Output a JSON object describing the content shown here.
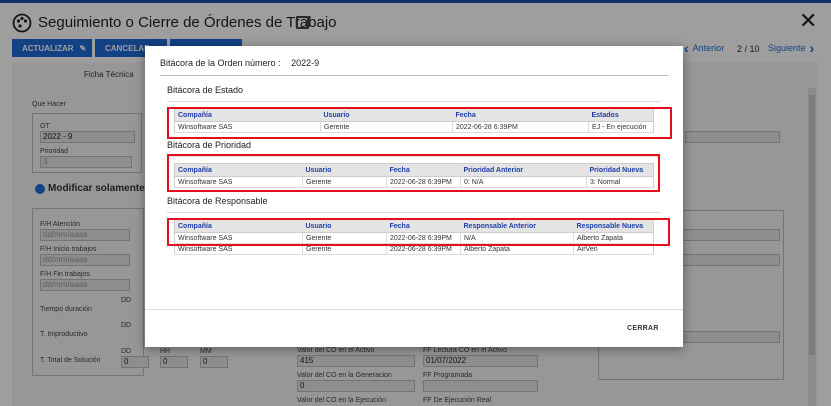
{
  "app": {
    "title": "Seguimiento o Cierre de Órdenes de Trabajo",
    "close_icon": "close-icon",
    "toolbar": {
      "update_label": "ACTUALIZAR",
      "cancel_label": "CANCELAR",
      "third_label": "OPCIONES"
    },
    "nav": {
      "prev_label": "Anterior",
      "counter": "2 / 10",
      "next_label": "Siguiente"
    }
  },
  "background": {
    "tab_label": "Ficha Técnica",
    "que_hacer_label": "Que Hacer",
    "ot_label": "OT",
    "ot_value": "2022 - 9",
    "prioridad_label": "Prioridad",
    "prioridad_value": "3",
    "modify_label": "Modificar solamente e",
    "fh_atencion_label": "F/H Atención",
    "fh_inicio_label": "F/H Inicio trabajos",
    "fh_fin_label": "F/H Fin trabajos",
    "date_placeholder": "dd/mm/aaaa",
    "tiempo_label": "Tiempo duración",
    "improductivo_label": "T. Improductivo",
    "total_label": "T. Total de Solución",
    "dd_label": "DD",
    "hh_label": "HH",
    "mm_label": "MM",
    "zero": "0",
    "valor_activo_label": "Valor del CO en el Activo",
    "valor_activo_value": "415",
    "ff_lectura_label": "FF Lectura CO en el Activo",
    "ff_lectura_value": "01/07/2022",
    "valor_generacion_label": "Valor del CO en la Generacion",
    "valor_generacion_value": "0",
    "ff_programada_label": "FF Programada",
    "valor_ejecucion_label": "Valor del CO en la Ejecución",
    "ff_ejecucion_label": "FF De Ejecución Real"
  },
  "modal": {
    "header_label": "Bitácora de la Orden número :",
    "order_number": "2022-9",
    "close_button": "CERRAR",
    "estado": {
      "title": "Bitácora de Estado",
      "columns": [
        "Compañía",
        "Usuario",
        "Fecha",
        "Estados"
      ],
      "rows": [
        [
          "Winsoftware SAS",
          "Gerente",
          "2022-06-28 6:39PM",
          "EJ - En ejecución"
        ]
      ]
    },
    "prioridad": {
      "title": "Bitácora de Prioridad",
      "columns": [
        "Compañía",
        "Usuario",
        "Fecha",
        "Prioridad Anterior",
        "Prioridad Nueva"
      ],
      "rows": [
        [
          "Winsoftware SAS",
          "Gerente",
          "2022-06-28 6:39PM",
          "0: N/A",
          "3: Normal"
        ]
      ]
    },
    "responsable": {
      "title": "Bitácora de Responsable",
      "columns": [
        "Compañía",
        "Usuario",
        "Fecha",
        "Responsable Anterior",
        "Responsable Nueva"
      ],
      "rows": [
        [
          "Winsoftware SAS",
          "Gerente",
          "2022-06-28 6:39PM",
          "N/A",
          "Alberto Zapata"
        ],
        [
          "Winsoftware SAS",
          "Gerente",
          "2022-06-28 6:39PM",
          "Alberto Zapata",
          "AirVen"
        ]
      ]
    }
  },
  "colors": {
    "brand": "#1f6bd6",
    "highlight_box": "#e3101c",
    "table_header_text": "#1f3fa8"
  }
}
